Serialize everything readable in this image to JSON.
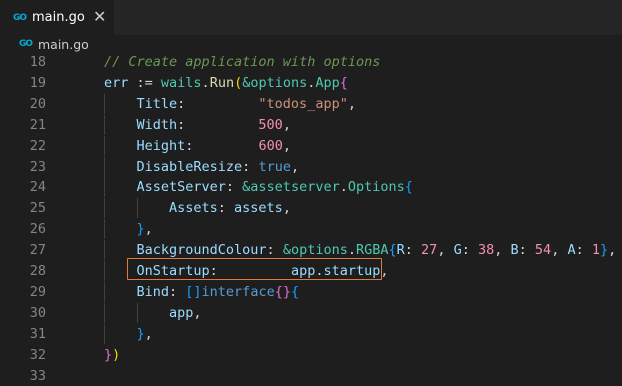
{
  "tab": {
    "label": "main.go",
    "icon": "go-file-icon",
    "close": "✕",
    "go_glyph": "GO"
  },
  "breadcrumb": {
    "label": "main.go",
    "go_glyph": "GO"
  },
  "lines": [
    {
      "num": "18",
      "indent": 0,
      "tokens": [
        {
          "t": "// Create application with options",
          "c": "c"
        }
      ]
    },
    {
      "num": "19",
      "indent": 0,
      "tokens": [
        {
          "t": "err",
          "c": "v"
        },
        {
          "t": " := ",
          "c": "p"
        },
        {
          "t": "wails",
          "c": "t"
        },
        {
          "t": ".",
          "c": "p"
        },
        {
          "t": "Run",
          "c": "f"
        },
        {
          "t": "(",
          "c": "b1"
        },
        {
          "t": "&options",
          "c": "t"
        },
        {
          "t": ".",
          "c": "p"
        },
        {
          "t": "App",
          "c": "t"
        },
        {
          "t": "{",
          "c": "b2"
        }
      ]
    },
    {
      "num": "20",
      "indent": 1,
      "tokens": [
        {
          "t": "Title",
          "c": "v"
        },
        {
          "t": ":         ",
          "c": "p"
        },
        {
          "t": "\"todos_app\"",
          "c": "s"
        },
        {
          "t": ",",
          "c": "p"
        }
      ]
    },
    {
      "num": "21",
      "indent": 1,
      "tokens": [
        {
          "t": "Width",
          "c": "v"
        },
        {
          "t": ":         ",
          "c": "p"
        },
        {
          "t": "500",
          "c": "n2"
        },
        {
          "t": ",",
          "c": "p"
        }
      ]
    },
    {
      "num": "22",
      "indent": 1,
      "tokens": [
        {
          "t": "Height",
          "c": "v"
        },
        {
          "t": ":        ",
          "c": "p"
        },
        {
          "t": "600",
          "c": "n2"
        },
        {
          "t": ",",
          "c": "p"
        }
      ]
    },
    {
      "num": "23",
      "indent": 1,
      "tokens": [
        {
          "t": "DisableResize",
          "c": "v"
        },
        {
          "t": ": ",
          "c": "p"
        },
        {
          "t": "true",
          "c": "k"
        },
        {
          "t": ",",
          "c": "p"
        }
      ]
    },
    {
      "num": "24",
      "indent": 1,
      "tokens": [
        {
          "t": "AssetServer",
          "c": "v"
        },
        {
          "t": ": ",
          "c": "p"
        },
        {
          "t": "&assetserver",
          "c": "t"
        },
        {
          "t": ".",
          "c": "p"
        },
        {
          "t": "Options",
          "c": "t"
        },
        {
          "t": "{",
          "c": "b3"
        }
      ]
    },
    {
      "num": "25",
      "indent": 2,
      "tokens": [
        {
          "t": "Assets",
          "c": "v"
        },
        {
          "t": ": ",
          "c": "p"
        },
        {
          "t": "assets",
          "c": "v"
        },
        {
          "t": ",",
          "c": "p"
        }
      ]
    },
    {
      "num": "26",
      "indent": 1,
      "tokens": [
        {
          "t": "}",
          "c": "b3"
        },
        {
          "t": ",",
          "c": "p"
        }
      ]
    },
    {
      "num": "27",
      "indent": 1,
      "tokens": [
        {
          "t": "BackgroundColour",
          "c": "v"
        },
        {
          "t": ": ",
          "c": "p"
        },
        {
          "t": "&options",
          "c": "t"
        },
        {
          "t": ".",
          "c": "p"
        },
        {
          "t": "RGBA",
          "c": "t"
        },
        {
          "t": "{",
          "c": "b3"
        },
        {
          "t": "R",
          "c": "v"
        },
        {
          "t": ": ",
          "c": "p"
        },
        {
          "t": "27",
          "c": "n2"
        },
        {
          "t": ", ",
          "c": "p"
        },
        {
          "t": "G",
          "c": "v"
        },
        {
          "t": ": ",
          "c": "p"
        },
        {
          "t": "38",
          "c": "n2"
        },
        {
          "t": ", ",
          "c": "p"
        },
        {
          "t": "B",
          "c": "v"
        },
        {
          "t": ": ",
          "c": "p"
        },
        {
          "t": "54",
          "c": "n2"
        },
        {
          "t": ", ",
          "c": "p"
        },
        {
          "t": "A",
          "c": "v"
        },
        {
          "t": ": ",
          "c": "p"
        },
        {
          "t": "1",
          "c": "n2"
        },
        {
          "t": "}",
          "c": "b3"
        },
        {
          "t": ",",
          "c": "p"
        }
      ]
    },
    {
      "num": "28",
      "indent": 1,
      "tokens": [
        {
          "t": "OnStartup",
          "c": "v"
        },
        {
          "t": ":         ",
          "c": "p"
        },
        {
          "t": "app",
          "c": "v"
        },
        {
          "t": ".",
          "c": "p"
        },
        {
          "t": "startup",
          "c": "v"
        },
        {
          "t": ",",
          "c": "p"
        }
      ]
    },
    {
      "num": "29",
      "indent": 1,
      "tokens": [
        {
          "t": "Bind",
          "c": "v"
        },
        {
          "t": ": ",
          "c": "p"
        },
        {
          "t": "[]",
          "c": "b3"
        },
        {
          "t": "interface",
          "c": "k"
        },
        {
          "t": "{}",
          "c": "b2"
        },
        {
          "t": "{",
          "c": "b3"
        }
      ]
    },
    {
      "num": "30",
      "indent": 2,
      "tokens": [
        {
          "t": "app",
          "c": "v"
        },
        {
          "t": ",",
          "c": "p"
        }
      ]
    },
    {
      "num": "31",
      "indent": 1,
      "tokens": [
        {
          "t": "}",
          "c": "b3"
        },
        {
          "t": ",",
          "c": "p"
        }
      ]
    },
    {
      "num": "32",
      "indent": 0,
      "tokens": [
        {
          "t": "}",
          "c": "b2"
        },
        {
          "t": ")",
          "c": "b1"
        }
      ]
    },
    {
      "num": "33",
      "indent": 0,
      "tokens": []
    }
  ],
  "highlighted_line": "28",
  "colors": {
    "highlight_border": "#e07b39",
    "background": "#1e1e1e"
  }
}
